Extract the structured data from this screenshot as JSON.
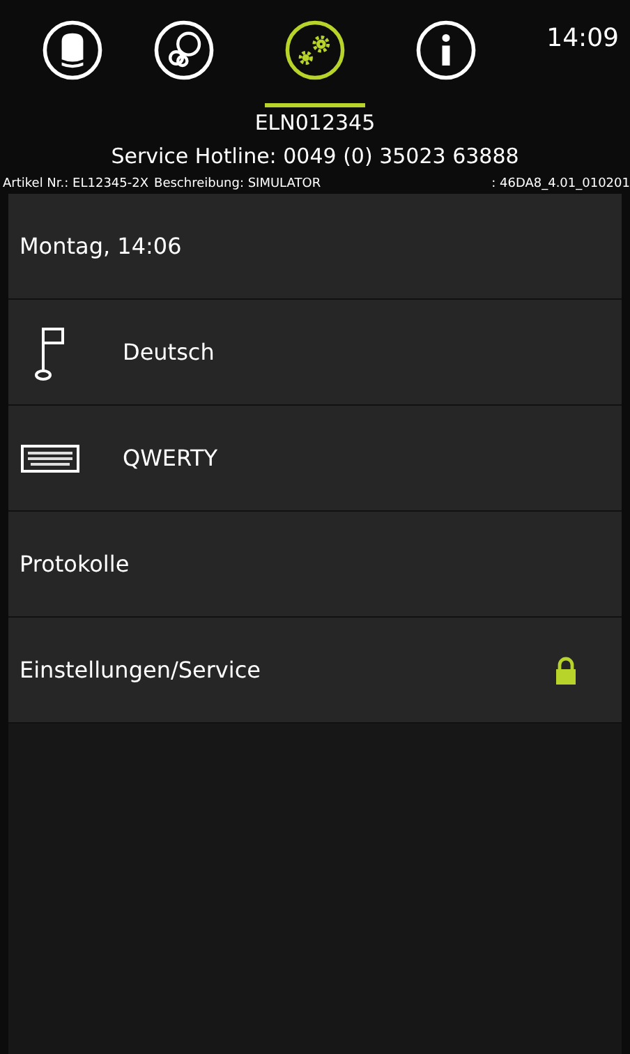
{
  "tabs": [
    {
      "kind": "chef",
      "selected": false
    },
    {
      "kind": "rings",
      "selected": false
    },
    {
      "kind": "gears",
      "selected": true
    },
    {
      "kind": "info",
      "selected": false
    }
  ],
  "clock": "14:09",
  "device_id": "ELN012345",
  "hotline": "Service Hotline: 0049 (0) 35023 63888",
  "info_line": [
    "Artikel Nr.: EL12345-2X",
    "Beschreibung: SIMULATOR",
    ": 46DA8_4.01_010201"
  ],
  "menu": [
    {
      "label": "Montag, 14:06",
      "kind": "plain",
      "locked": false
    },
    {
      "label": "Deutsch",
      "kind": "flag",
      "locked": false
    },
    {
      "label": "QWERTY",
      "kind": "keyboard",
      "locked": false
    },
    {
      "label": "Protokolle",
      "kind": "plain",
      "locked": false
    },
    {
      "label": "Einstellungen/Service",
      "kind": "plain",
      "locked": true
    }
  ]
}
